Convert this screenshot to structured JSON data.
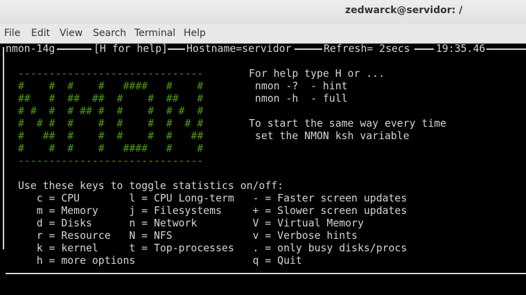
{
  "window": {
    "title": "zedwarck@servidor: /"
  },
  "menu": {
    "file": "File",
    "edit": "Edit",
    "view": "View",
    "search": "Search",
    "terminal": "Terminal",
    "help": "Help"
  },
  "header": {
    "app": "nmon-14g",
    "help_hint": "[H for help]",
    "hostname": "Hostname=servidor",
    "refresh": "Refresh= 2secs",
    "time": "19:35.46"
  },
  "logo": [
    "------------------------------",
    "#    #  #    #   ####   #    #",
    "##   #  ##  ##  #    #  ##   #",
    "# #  #  # ## #  #    #  # #  #",
    "#  # #  #    #  #    #  #  # #",
    "#   ##  #    #  #    #  #   ##",
    "#    #  #    #   ####   #    #",
    "------------------------------"
  ],
  "help_text": {
    "line1": "For help type H or ...",
    "line2": " nmon -?  - hint",
    "line3": " nmon -h  - full",
    "line4": "To start the same way every time",
    "line5": " set the NMON ksh variable"
  },
  "keys": {
    "heading": "Use these keys to toggle statistics on/off:",
    "rows": [
      "   c = CPU        l = CPU Long-term   - = Faster screen updates",
      "   m = Memory     j = Filesystems     + = Slower screen updates",
      "   d = Disks      n = Network         V = Virtual Memory",
      "   r = Resource   N = NFS             v = Verbose hints",
      "   k = kernel     t = Top-processes   . = only busy disks/procs",
      "   h = more options                   q = Quit"
    ]
  }
}
